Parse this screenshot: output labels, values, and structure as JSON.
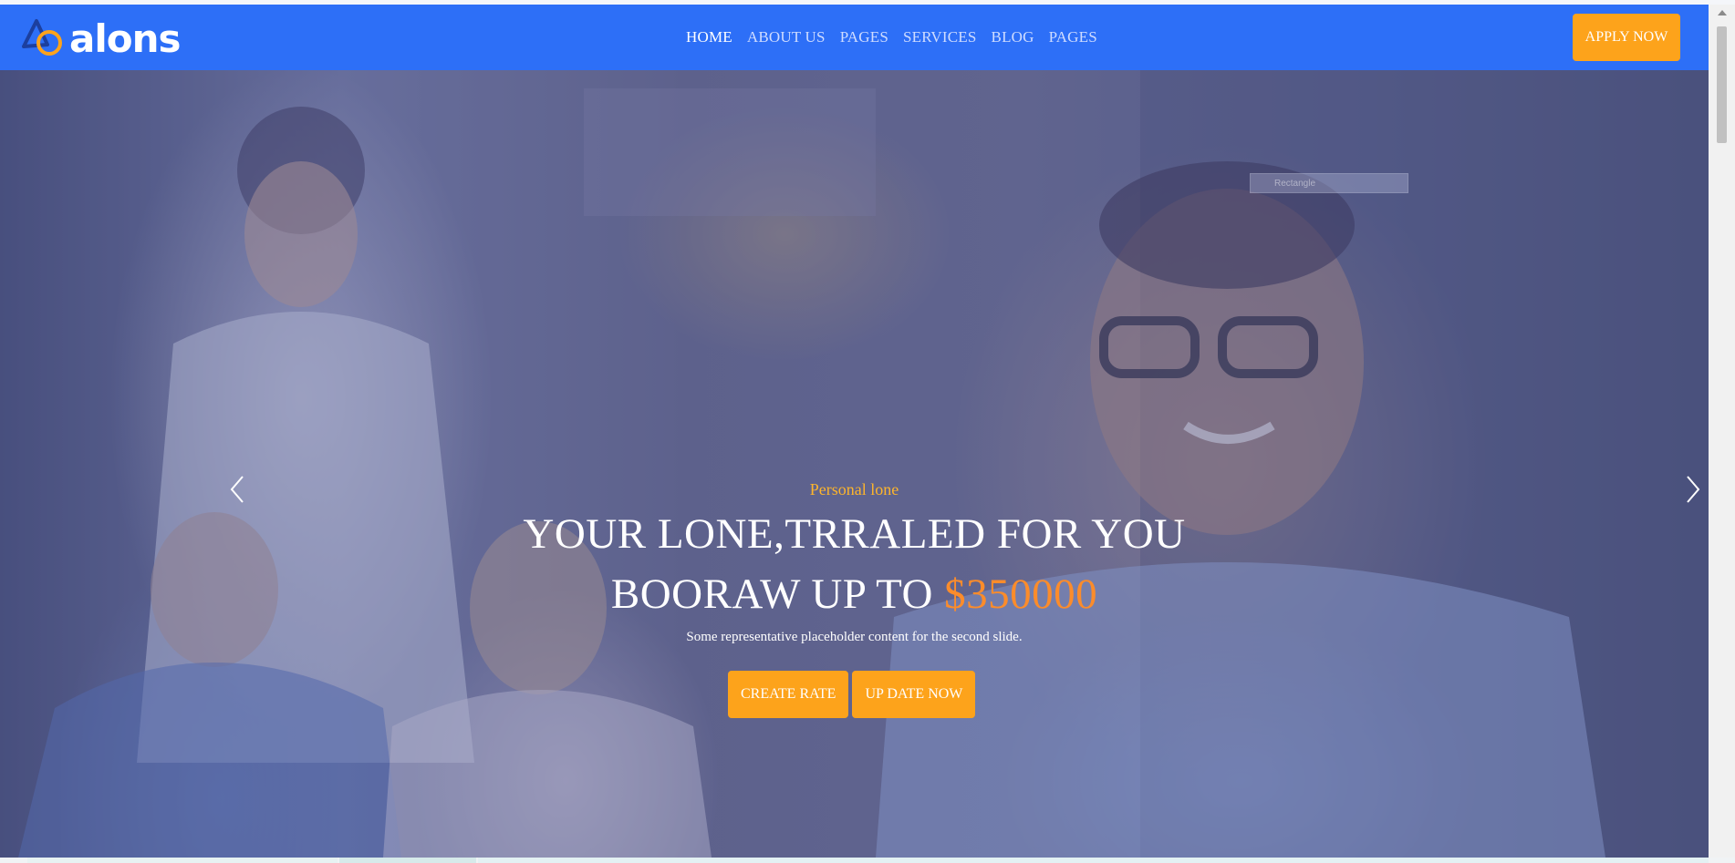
{
  "header": {
    "logo_text": "alons",
    "nav": [
      {
        "label": "HOME",
        "active": true
      },
      {
        "label": "ABOUT US",
        "active": false
      },
      {
        "label": "PAGES",
        "active": false
      },
      {
        "label": "SERVICES",
        "active": false
      },
      {
        "label": "BLOG",
        "active": false
      },
      {
        "label": "PAGES",
        "active": false
      }
    ],
    "apply_label": "APPLY NOW"
  },
  "hero": {
    "subtitle": "Personal lone",
    "title_line1": "YOUR LONE,TRRALED FOR YOU",
    "title_line2_prefix": "BOORAW UP TO ",
    "title_line2_amount": "$350000",
    "description": "Some representative placeholder content for the second slide.",
    "cta_primary": "CREATE RATE",
    "cta_secondary": "UP DATE NOW",
    "ghost_label": "Rectangle"
  },
  "colors": {
    "brand_blue": "#2d6ff7",
    "accent_orange": "#fda31b",
    "amount_orange": "#fb8c2b",
    "subtitle_gold": "#fdb52c"
  },
  "icons": {
    "logo": "triangle-circle-logo-icon",
    "prev": "chevron-left-icon",
    "next": "chevron-right-icon"
  }
}
